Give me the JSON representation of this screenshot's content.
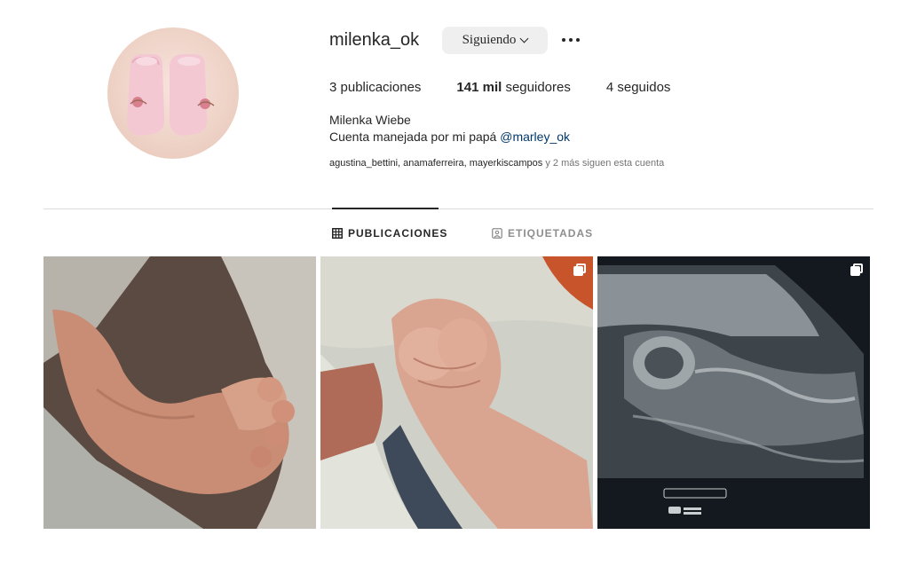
{
  "profile": {
    "username": "milenka_ok",
    "follow_button_label": "Siguiendo",
    "stats": {
      "posts_count": "3",
      "posts_label": "publicaciones",
      "followers_count": "141 mil",
      "followers_label": "seguidores",
      "following_count": "4",
      "following_label": "seguidos"
    },
    "full_name": "Milenka Wiebe",
    "bio_text": "Cuenta manejada por mi papá ",
    "bio_mention": "@marley_ok",
    "followed_by_names": "agustina_bettini, anamaferreira, mayerkiscampos",
    "followed_by_suffix": " y 2 más siguen esta cuenta"
  },
  "tabs": [
    {
      "label": "PUBLICACIONES",
      "icon": "grid-icon",
      "active": true
    },
    {
      "label": "ETIQUETADAS",
      "icon": "tagged-icon",
      "active": false
    }
  ],
  "posts": [
    {
      "subject": "baby-feet-photo",
      "multi": false
    },
    {
      "subject": "baby-hand-photo",
      "multi": true
    },
    {
      "subject": "ultrasound-photo",
      "multi": true
    }
  ],
  "colors": {
    "mention_link": "#00376b",
    "button_bg": "#efefef",
    "muted_text": "#737373"
  }
}
